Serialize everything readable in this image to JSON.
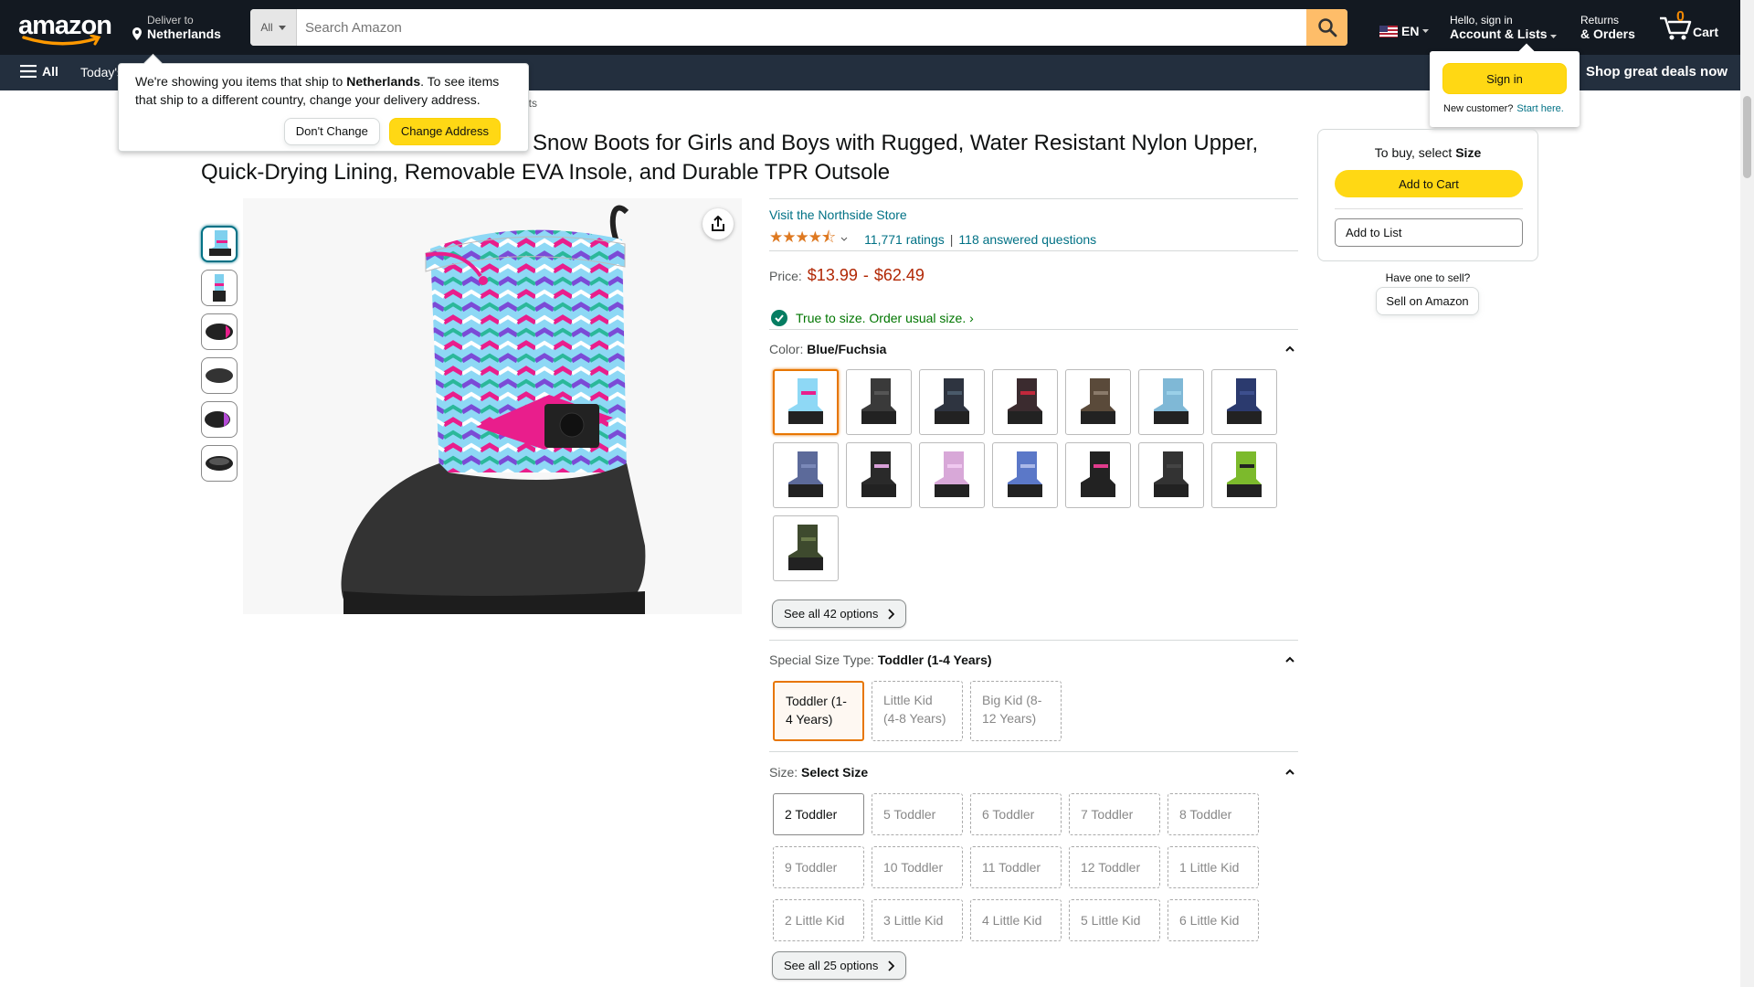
{
  "header": {
    "logo": "amazon",
    "deliver_line1": "Deliver to",
    "deliver_line2": "Netherlands",
    "search_dept": "All",
    "search_placeholder": "Search Amazon",
    "lang": "EN",
    "account_line1": "Hello, sign in",
    "account_line2": "Account & Lists",
    "returns_line1": "Returns",
    "returns_line2": "& Orders",
    "cart_count": "0",
    "cart_label": "Cart"
  },
  "subnav": {
    "all": "All",
    "today": "Today's",
    "deals": "Shop great deals now"
  },
  "breadcrumb_fragment": "ots",
  "ship_popover": {
    "text_before": "We're showing you items that ship to ",
    "country": "Netherlands",
    "text_after": ". To see items that ship to a different country, change your delivery address.",
    "dont_change": "Don't Change",
    "change_address": "Change Address"
  },
  "signin_popover": {
    "button": "Sign in",
    "new_customer": "New customer?",
    "start_here": "Start here."
  },
  "product": {
    "title_line1": "Snow Boots for Girls and Boys with Rugged, Water Resistant Nylon Upper,",
    "title_line2": "Quick-Drying Lining, Removable EVA Insole, and Durable TPR Outsole",
    "store": "Visit the Northside Store",
    "ratings": "11,771 ratings",
    "answered": "118 answered questions",
    "price_label": "Price:",
    "price_low": "$13.99",
    "price_sep": "-",
    "price_high": "$62.49",
    "fit": "True to size. Order usual size. ›",
    "color_label": "Color: ",
    "color_value": "Blue/Fuchsia",
    "color_see_all": "See all 42 options",
    "special_label": "Special Size Type: ",
    "special_value": "Toddler (1-4 Years)",
    "special_options": [
      "Toddler (1-4 Years)",
      "Little Kid (4-8 Years)",
      "Big Kid (8-12 Years)"
    ],
    "size_label": "Size: ",
    "size_value": "Select Size",
    "sizes": [
      "2 Toddler",
      "5 Toddler",
      "6 Toddler",
      "7 Toddler",
      "8 Toddler",
      "9 Toddler",
      "10 Toddler",
      "11 Toddler",
      "12 Toddler",
      "1 Little Kid",
      "2 Little Kid",
      "3 Little Kid",
      "4 Little Kid",
      "5 Little Kid",
      "6 Little Kid"
    ],
    "size_see_all": "See all 25 options"
  },
  "buybox": {
    "to_buy": "To buy, select ",
    "to_buy_bold": "Size",
    "add_to_cart": "Add to Cart",
    "add_to_list": "Add to List",
    "have_one": "Have one to sell?",
    "sell": "Sell on Amazon"
  },
  "colors": {
    "accent_orange": "#e77600",
    "link": "#007185",
    "price_red": "#b12704",
    "nav_dark": "#131921",
    "subnav": "#232f3e",
    "button_yellow": "#ffd814"
  }
}
